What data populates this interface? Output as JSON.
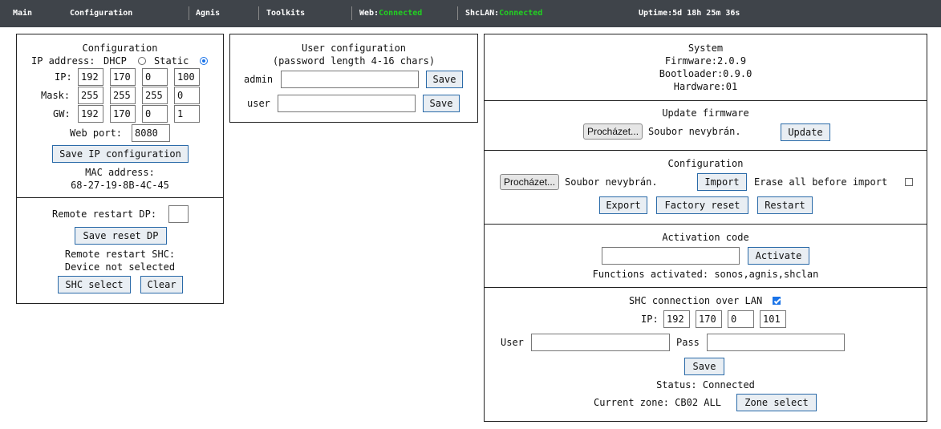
{
  "topbar": {
    "nav": [
      "Main",
      "Configuration",
      "Agnis",
      "Toolkits"
    ],
    "web_label": "Web:",
    "web_status": "Connected",
    "shclan_label": "ShcLAN:",
    "shclan_status": "Connected",
    "uptime_label": "Uptime:",
    "uptime_value": "5d 18h 25m 36s",
    "status_color": "#21d121"
  },
  "network": {
    "title": "Configuration",
    "ip_address_label": "IP address:",
    "dhcp_label": "DHCP",
    "static_label": "Static",
    "selected_mode": "Static",
    "ip_label": "IP:",
    "ip": [
      "192",
      "170",
      "0",
      "100"
    ],
    "mask_label": "Mask:",
    "mask": [
      "255",
      "255",
      "255",
      "0"
    ],
    "gw_label": "GW:",
    "gw": [
      "192",
      "170",
      "0",
      "1"
    ],
    "web_port_label": "Web port:",
    "web_port": "8080",
    "save_button": "Save IP configuration",
    "mac_label": "MAC address:",
    "mac_value": "68-27-19-8B-4C-45"
  },
  "restart": {
    "dp_label": "Remote restart DP:",
    "dp_value": "",
    "save_reset_button": "Save reset DP",
    "shc_label": "Remote restart SHC:",
    "shc_device": "Device not selected",
    "shc_select_button": "SHC select",
    "clear_button": "Clear"
  },
  "users": {
    "title": "User configuration",
    "subtitle": "(password length 4-16 chars)",
    "rows": [
      {
        "label": "admin",
        "value": "",
        "button": "Save"
      },
      {
        "label": "user",
        "value": "",
        "button": "Save"
      }
    ]
  },
  "system": {
    "title": "System",
    "firmware": "Firmware:2.0.9",
    "bootloader": "Bootloader:0.9.0",
    "hardware": "Hardware:01"
  },
  "update": {
    "title": "Update firmware",
    "browse_button": "Procházet...",
    "file_status": "Soubor nevybrán.",
    "update_button": "Update"
  },
  "config_io": {
    "title": "Configuration",
    "browse_button": "Procházet...",
    "file_status": "Soubor nevybrán.",
    "import_button": "Import",
    "erase_label": "Erase all before import",
    "erase_checked": false,
    "export_button": "Export",
    "factory_reset_button": "Factory reset",
    "restart_button": "Restart"
  },
  "activation": {
    "title": "Activation code",
    "code_value": "",
    "activate_button": "Activate",
    "functions": "Functions activated: sonos,agnis,shclan"
  },
  "shc": {
    "title": "SHC connection over LAN",
    "enabled": true,
    "ip_label": "IP:",
    "ip": [
      "192",
      "170",
      "0",
      "101"
    ],
    "user_label": "User",
    "user_value": "",
    "pass_label": "Pass",
    "pass_value": "",
    "save_button": "Save",
    "status": "Status: Connected",
    "zone_label": "Current zone: CB02 ALL",
    "zone_select_button": "Zone select"
  }
}
